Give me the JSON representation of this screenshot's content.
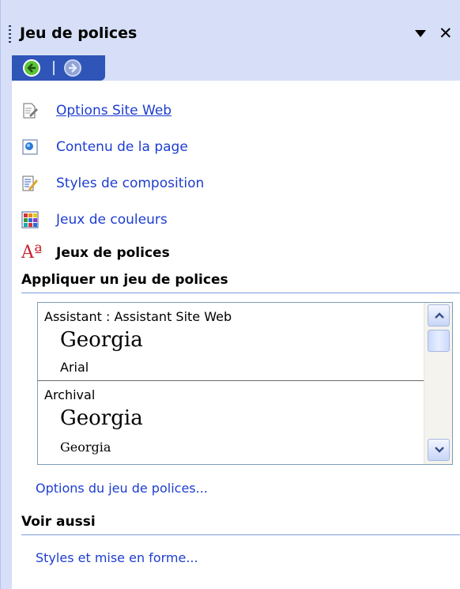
{
  "pane": {
    "title": "Jeu de polices",
    "nav_items": [
      {
        "label": "Options Site Web",
        "icon": "page-edit-icon"
      },
      {
        "label": "Contenu de la page",
        "icon": "page-content-icon"
      },
      {
        "label": "Styles de composition",
        "icon": "layout-styles-icon"
      },
      {
        "label": "Jeux de couleurs",
        "icon": "color-grid-icon"
      },
      {
        "label": "Jeux de polices",
        "icon": "font-scheme-icon"
      }
    ],
    "apply_heading": "Appliquer un jeu de polices",
    "font_sets": [
      {
        "name": "Assistant : Assistant Site Web",
        "heading_font": "Georgia",
        "body_font": "Arial"
      },
      {
        "name": "Archival",
        "heading_font": "Georgia",
        "body_font": "Georgia"
      }
    ],
    "options_link": "Options du jeu de polices...",
    "see_also_heading": "Voir aussi",
    "see_also_link": "Styles et mise en forme...",
    "font_icon_glyph": "Aª"
  },
  "colors": {
    "pane_bg": "#d6dff7",
    "nav_strip": "#2f55b8",
    "link": "#1d3dd0",
    "section_rule": "#7b9cd8"
  }
}
